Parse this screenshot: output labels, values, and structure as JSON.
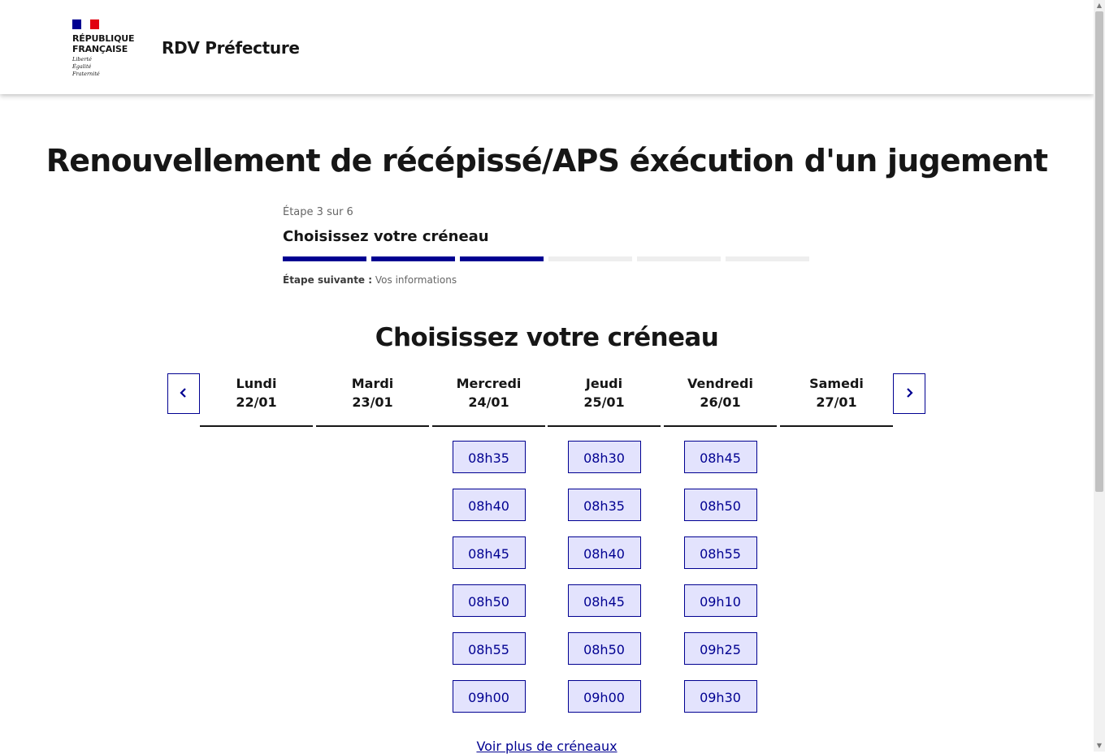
{
  "header": {
    "logo_lines": [
      "RÉPUBLIQUE",
      "FRANÇAISE"
    ],
    "motto_lines": [
      "Liberté",
      "Égalité",
      "Fraternité"
    ],
    "service_title": "RDV Préfecture"
  },
  "page": {
    "title": "Renouvellement de récépissé/APS éxécution d'un jugement"
  },
  "stepper": {
    "state": "Étape 3 sur 6",
    "title": "Choisissez votre créneau",
    "current_step": 3,
    "total_steps": 6,
    "next_label": "Étape suivante :",
    "next_value": "Vos informations"
  },
  "calendar": {
    "title": "Choisissez votre créneau",
    "days": [
      {
        "name": "Lundi",
        "date": "22/01",
        "slots": []
      },
      {
        "name": "Mardi",
        "date": "23/01",
        "slots": []
      },
      {
        "name": "Mercredi",
        "date": "24/01",
        "slots": [
          "08h35",
          "08h40",
          "08h45",
          "08h50",
          "08h55",
          "09h00"
        ]
      },
      {
        "name": "Jeudi",
        "date": "25/01",
        "slots": [
          "08h30",
          "08h35",
          "08h40",
          "08h45",
          "08h50",
          "09h00"
        ]
      },
      {
        "name": "Vendredi",
        "date": "26/01",
        "slots": [
          "08h45",
          "08h50",
          "08h55",
          "09h10",
          "09h25",
          "09h30"
        ]
      },
      {
        "name": "Samedi",
        "date": "27/01",
        "slots": []
      }
    ],
    "prev_icon": "chevron-left-icon",
    "next_icon": "chevron-right-icon",
    "more_link": "Voir plus de créneaux"
  },
  "colors": {
    "accent": "#000091",
    "slot_bg": "#e3e3fd",
    "flag_blue": "#000091",
    "flag_red": "#e1000f"
  }
}
